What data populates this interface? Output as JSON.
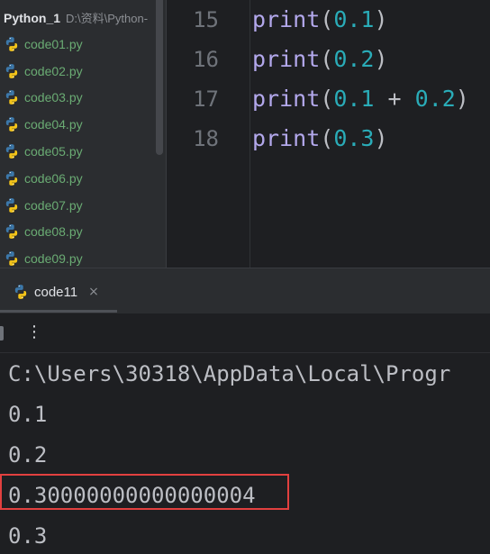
{
  "project": {
    "name": "Python_1",
    "path": "D:\\资料\\Python-",
    "files": [
      "code01.py",
      "code02.py",
      "code03.py",
      "code04.py",
      "code05.py",
      "code06.py",
      "code07.py",
      "code08.py",
      "code09.py"
    ],
    "file_icon": "python-icon"
  },
  "editor": {
    "lines": [
      {
        "number": "15",
        "fn": "print",
        "open": "(",
        "args": [
          {
            "t": "num",
            "v": "0.1"
          }
        ],
        "close": ")"
      },
      {
        "number": "16",
        "fn": "print",
        "open": "(",
        "args": [
          {
            "t": "num",
            "v": "0.2"
          }
        ],
        "close": ")"
      },
      {
        "number": "17",
        "fn": "print",
        "open": "(",
        "args": [
          {
            "t": "num",
            "v": "0.1"
          },
          {
            "t": "op",
            "v": " + "
          },
          {
            "t": "num",
            "v": "0.2"
          }
        ],
        "close": ")"
      },
      {
        "number": "18",
        "fn": "print",
        "open": "(",
        "args": [
          {
            "t": "num",
            "v": "0.3"
          }
        ],
        "close": ")"
      }
    ],
    "colors": {
      "function": "#b3a8ec",
      "number": "#2aacb8",
      "text": "#bcbec4"
    }
  },
  "run_panel": {
    "tab_label": "code11",
    "tab_close": "×",
    "more_menu": "⋮"
  },
  "console": {
    "lines": [
      "C:\\Users\\30318\\AppData\\Local\\Progr",
      "0.1",
      "0.2",
      "0.30000000000000004",
      "0.3"
    ],
    "highlight_color": "#e2403f"
  }
}
